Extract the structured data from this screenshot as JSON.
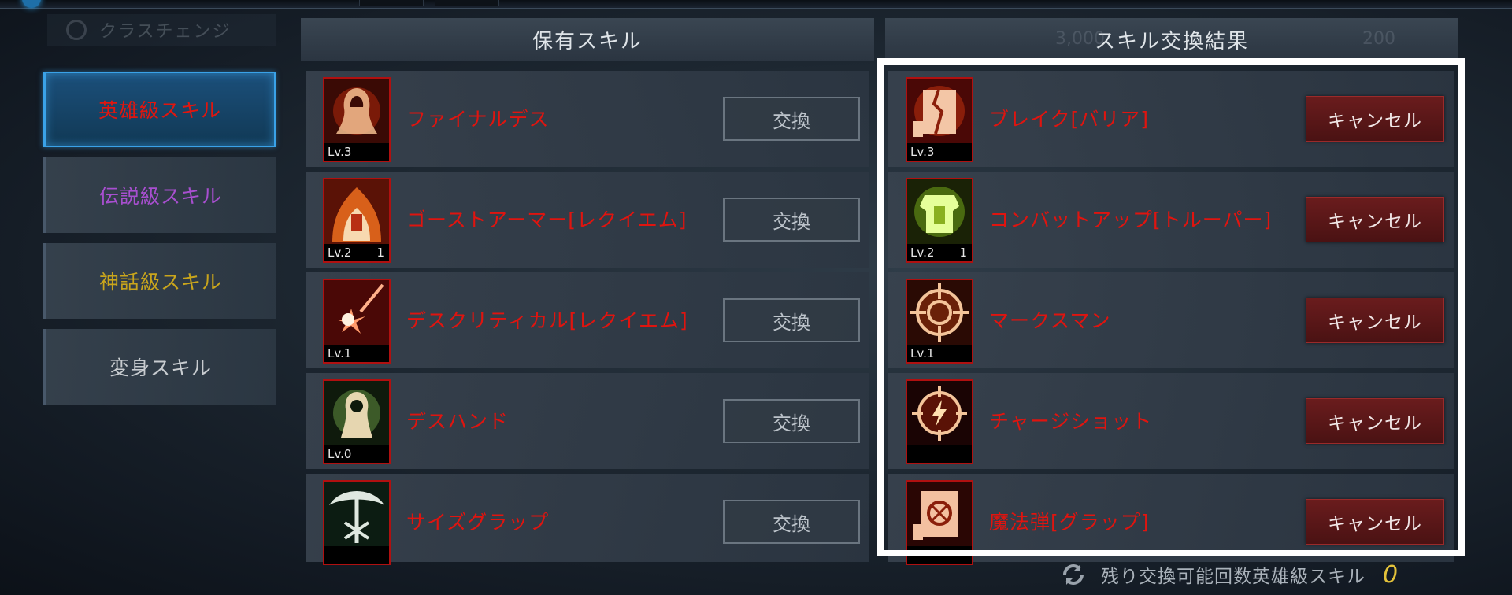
{
  "header": {
    "ghost_title": "クラスチェンジ",
    "owned_title": "保有スキル",
    "result_title": "スキル交換結果",
    "ghost_stats": [
      "3,000",
      "200"
    ]
  },
  "categories": [
    {
      "label": "英雄級スキル",
      "color": "#e0160f",
      "active": true
    },
    {
      "label": "伝説級スキル",
      "color": "#a84fd0",
      "active": false
    },
    {
      "label": "神話級スキル",
      "color": "#c9a51c",
      "active": false
    },
    {
      "label": "変身スキル",
      "color": "#c8ccd0",
      "active": false
    }
  ],
  "owned_skills": [
    {
      "name": "ファイナルデス",
      "level": "Lv.3",
      "count": "",
      "icon": "hooded-figure-icon",
      "button": "交換"
    },
    {
      "name": "ゴーストアーマー[レクイエム]",
      "level": "Lv.2",
      "count": "1",
      "icon": "flaming-armor-icon",
      "button": "交換"
    },
    {
      "name": "デスクリティカル[レクイエム]",
      "level": "Lv.1",
      "count": "",
      "icon": "critical-burst-icon",
      "button": "交換"
    },
    {
      "name": "デスハンド",
      "level": "Lv.0",
      "count": "",
      "icon": "reaper-hand-icon",
      "button": "交換"
    },
    {
      "name": "サイズグラップ",
      "level": "",
      "count": "",
      "icon": "scythe-grapple-icon",
      "button": "交換"
    }
  ],
  "result_skills": [
    {
      "name": "ブレイク[バリア]",
      "level": "Lv.3",
      "count": "",
      "icon": "broken-scroll-icon",
      "button": "キャンセル"
    },
    {
      "name": "コンバットアップ[トルーパー]",
      "level": "Lv.2",
      "count": "1",
      "icon": "combat-armor-icon",
      "button": "キャンセル"
    },
    {
      "name": "マークスマン",
      "level": "Lv.1",
      "count": "",
      "icon": "crosshair-icon",
      "button": "キャンセル"
    },
    {
      "name": "チャージショット",
      "level": "",
      "count": "",
      "icon": "charge-shot-icon",
      "button": "キャンセル"
    },
    {
      "name": "魔法弾[グラップ]",
      "level": "",
      "count": "",
      "icon": "magic-bullet-scroll-icon",
      "button": "キャンセル"
    }
  ],
  "footer": {
    "label": "残り交換可能回数英雄級スキル",
    "count": "0"
  },
  "colors": {
    "skill_name": "#e0140f",
    "active_tab_border": "#3aa2e8",
    "count_highlight": "#e3c23a",
    "cancel_button": "#5a1718"
  }
}
